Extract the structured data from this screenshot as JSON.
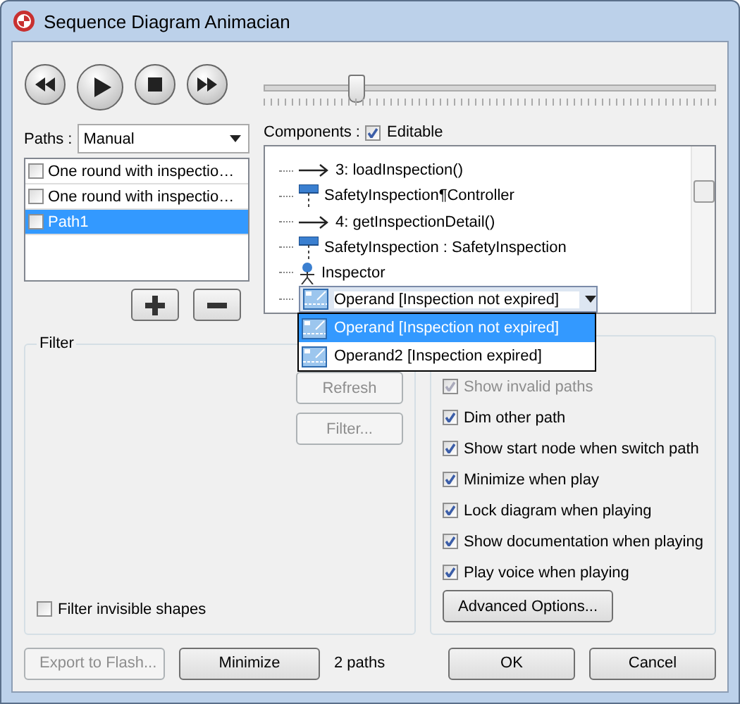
{
  "window": {
    "title": "Sequence Diagram Animacian"
  },
  "player": {
    "buttons": [
      {
        "kind": "rewind"
      },
      {
        "kind": "play"
      },
      {
        "kind": "stop"
      },
      {
        "kind": "forward"
      }
    ],
    "slider": {
      "level": 0.2
    }
  },
  "paths": {
    "label": "Paths :",
    "mode": "Manual",
    "items": [
      {
        "text": "One round with inspectio…",
        "checked": false,
        "selected": false
      },
      {
        "text": "One round with inspectio…",
        "checked": false,
        "selected": false
      },
      {
        "text": "Path1",
        "checked": false,
        "selected": true
      }
    ]
  },
  "components": {
    "label": "Components :",
    "editable": {
      "label": "Editable",
      "checked": true
    },
    "items": [
      {
        "kind": "message",
        "text": "3: loadInspection()"
      },
      {
        "kind": "lifeline",
        "text": "SafetyInspection¶Controller"
      },
      {
        "kind": "message",
        "text": "4: getInspectionDetail()"
      },
      {
        "kind": "lifeline",
        "text": "SafetyInspection : SafetyInspection"
      },
      {
        "kind": "actor",
        "text": "Inspector"
      }
    ],
    "combo": {
      "value": "Operand [Inspection not expired]",
      "options": [
        {
          "text": "Operand [Inspection not expired]",
          "selected": true
        },
        {
          "text": "Operand2 [Inspection expired]",
          "selected": false
        }
      ]
    }
  },
  "filter": {
    "title": "Filter",
    "buttons": [
      {
        "label": "Refresh",
        "disabled": true
      },
      {
        "label": "Filter...",
        "disabled": true
      }
    ],
    "invisible": {
      "label": "Filter invisible shapes",
      "checked": false
    }
  },
  "options": {
    "items": [
      {
        "label": "Show invalid paths",
        "checked": true,
        "disabled": true
      },
      {
        "label": "Dim other path",
        "checked": true,
        "disabled": false
      },
      {
        "label": "Show start node when switch path",
        "checked": true,
        "disabled": false
      },
      {
        "label": "Minimize when play",
        "checked": true,
        "disabled": false
      },
      {
        "label": "Lock diagram when playing",
        "checked": true,
        "disabled": false
      },
      {
        "label": "Show documentation when playing",
        "checked": true,
        "disabled": false
      },
      {
        "label": "Play voice when playing",
        "checked": true,
        "disabled": false
      }
    ],
    "advanced": "Advanced Options..."
  },
  "footer": {
    "buttons": [
      {
        "label": "Export to Flash...",
        "disabled": true
      },
      {
        "label": "Minimize",
        "disabled": false
      }
    ],
    "count": "2 paths",
    "actions": [
      {
        "label": "OK"
      },
      {
        "label": "Cancel"
      }
    ]
  }
}
